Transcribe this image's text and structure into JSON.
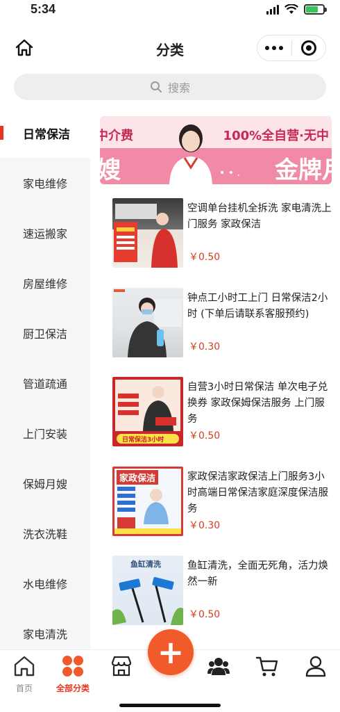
{
  "status_bar": {
    "time": "5:34"
  },
  "nav": {
    "title": "分类"
  },
  "search": {
    "placeholder": "搜索"
  },
  "sidebar": {
    "items": [
      {
        "label": "日常保洁",
        "active": true
      },
      {
        "label": "家电维修"
      },
      {
        "label": "速运搬家"
      },
      {
        "label": "房屋维修"
      },
      {
        "label": "厨卫保洁"
      },
      {
        "label": "管道疏通"
      },
      {
        "label": "上门安装"
      },
      {
        "label": "保姆月嫂"
      },
      {
        "label": "洗衣洗鞋"
      },
      {
        "label": "水电维修"
      },
      {
        "label": "家电清洗"
      }
    ]
  },
  "banner": {
    "text_left_top": "中介费",
    "text_right_top": "100%全自营·无中",
    "text_left_bottom": "嫂",
    "text_right_bottom": "金牌月",
    "dots": "• • ."
  },
  "products": [
    {
      "title": "空调单台挂机全拆洗 家电清洗上门服务 家政保洁",
      "price": "￥0.50",
      "thumb_text": ""
    },
    {
      "title": "钟点工小时工上门 日常保洁2小时 (下单后请联系客服预约)",
      "price": "￥0.30",
      "thumb_text": ""
    },
    {
      "title": "自营3小时日常保洁 单次电子兑换券 家政保姆保洁服务 上门服务",
      "price": "￥0.50",
      "thumb_text": "日常保洁3小时"
    },
    {
      "title": "家政保洁家政保洁上门服务3小时高端日常保洁家庭深度保洁服务",
      "price": "￥0.30",
      "thumb_text": "家政保洁"
    },
    {
      "title": "鱼缸清洗，全面无死角，活力焕然一新",
      "price": "￥0.50",
      "thumb_text": "鱼缸清洗"
    }
  ],
  "tabbar": {
    "items": [
      {
        "label": "首页",
        "icon": "home-icon"
      },
      {
        "label": "全部分类",
        "icon": "category-icon",
        "active": true
      },
      {
        "label": "",
        "icon": "store-icon"
      },
      {
        "label": "",
        "icon": "plus-icon"
      },
      {
        "label": "",
        "icon": "users-icon"
      },
      {
        "label": "",
        "icon": "cart-icon"
      },
      {
        "label": "",
        "icon": "user-icon"
      }
    ],
    "fab_symbol": "+"
  },
  "colors": {
    "accent": "#e8341f",
    "price": "#d43c1f",
    "fab": "#f15a2b"
  }
}
